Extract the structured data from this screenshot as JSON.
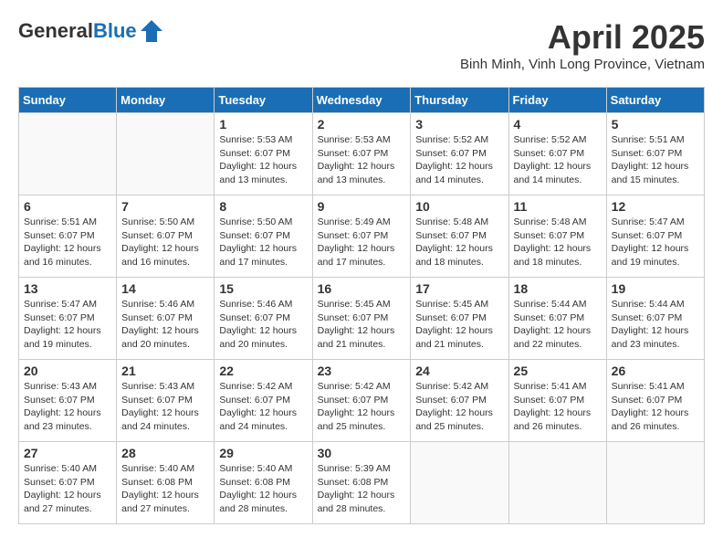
{
  "header": {
    "logo_line1": "General",
    "logo_line2": "Blue",
    "month": "April 2025",
    "location": "Binh Minh, Vinh Long Province, Vietnam"
  },
  "days_of_week": [
    "Sunday",
    "Monday",
    "Tuesday",
    "Wednesday",
    "Thursday",
    "Friday",
    "Saturday"
  ],
  "weeks": [
    [
      {
        "day": "",
        "info": ""
      },
      {
        "day": "",
        "info": ""
      },
      {
        "day": "1",
        "info": "Sunrise: 5:53 AM\nSunset: 6:07 PM\nDaylight: 12 hours\nand 13 minutes."
      },
      {
        "day": "2",
        "info": "Sunrise: 5:53 AM\nSunset: 6:07 PM\nDaylight: 12 hours\nand 13 minutes."
      },
      {
        "day": "3",
        "info": "Sunrise: 5:52 AM\nSunset: 6:07 PM\nDaylight: 12 hours\nand 14 minutes."
      },
      {
        "day": "4",
        "info": "Sunrise: 5:52 AM\nSunset: 6:07 PM\nDaylight: 12 hours\nand 14 minutes."
      },
      {
        "day": "5",
        "info": "Sunrise: 5:51 AM\nSunset: 6:07 PM\nDaylight: 12 hours\nand 15 minutes."
      }
    ],
    [
      {
        "day": "6",
        "info": "Sunrise: 5:51 AM\nSunset: 6:07 PM\nDaylight: 12 hours\nand 16 minutes."
      },
      {
        "day": "7",
        "info": "Sunrise: 5:50 AM\nSunset: 6:07 PM\nDaylight: 12 hours\nand 16 minutes."
      },
      {
        "day": "8",
        "info": "Sunrise: 5:50 AM\nSunset: 6:07 PM\nDaylight: 12 hours\nand 17 minutes."
      },
      {
        "day": "9",
        "info": "Sunrise: 5:49 AM\nSunset: 6:07 PM\nDaylight: 12 hours\nand 17 minutes."
      },
      {
        "day": "10",
        "info": "Sunrise: 5:48 AM\nSunset: 6:07 PM\nDaylight: 12 hours\nand 18 minutes."
      },
      {
        "day": "11",
        "info": "Sunrise: 5:48 AM\nSunset: 6:07 PM\nDaylight: 12 hours\nand 18 minutes."
      },
      {
        "day": "12",
        "info": "Sunrise: 5:47 AM\nSunset: 6:07 PM\nDaylight: 12 hours\nand 19 minutes."
      }
    ],
    [
      {
        "day": "13",
        "info": "Sunrise: 5:47 AM\nSunset: 6:07 PM\nDaylight: 12 hours\nand 19 minutes."
      },
      {
        "day": "14",
        "info": "Sunrise: 5:46 AM\nSunset: 6:07 PM\nDaylight: 12 hours\nand 20 minutes."
      },
      {
        "day": "15",
        "info": "Sunrise: 5:46 AM\nSunset: 6:07 PM\nDaylight: 12 hours\nand 20 minutes."
      },
      {
        "day": "16",
        "info": "Sunrise: 5:45 AM\nSunset: 6:07 PM\nDaylight: 12 hours\nand 21 minutes."
      },
      {
        "day": "17",
        "info": "Sunrise: 5:45 AM\nSunset: 6:07 PM\nDaylight: 12 hours\nand 21 minutes."
      },
      {
        "day": "18",
        "info": "Sunrise: 5:44 AM\nSunset: 6:07 PM\nDaylight: 12 hours\nand 22 minutes."
      },
      {
        "day": "19",
        "info": "Sunrise: 5:44 AM\nSunset: 6:07 PM\nDaylight: 12 hours\nand 23 minutes."
      }
    ],
    [
      {
        "day": "20",
        "info": "Sunrise: 5:43 AM\nSunset: 6:07 PM\nDaylight: 12 hours\nand 23 minutes."
      },
      {
        "day": "21",
        "info": "Sunrise: 5:43 AM\nSunset: 6:07 PM\nDaylight: 12 hours\nand 24 minutes."
      },
      {
        "day": "22",
        "info": "Sunrise: 5:42 AM\nSunset: 6:07 PM\nDaylight: 12 hours\nand 24 minutes."
      },
      {
        "day": "23",
        "info": "Sunrise: 5:42 AM\nSunset: 6:07 PM\nDaylight: 12 hours\nand 25 minutes."
      },
      {
        "day": "24",
        "info": "Sunrise: 5:42 AM\nSunset: 6:07 PM\nDaylight: 12 hours\nand 25 minutes."
      },
      {
        "day": "25",
        "info": "Sunrise: 5:41 AM\nSunset: 6:07 PM\nDaylight: 12 hours\nand 26 minutes."
      },
      {
        "day": "26",
        "info": "Sunrise: 5:41 AM\nSunset: 6:07 PM\nDaylight: 12 hours\nand 26 minutes."
      }
    ],
    [
      {
        "day": "27",
        "info": "Sunrise: 5:40 AM\nSunset: 6:07 PM\nDaylight: 12 hours\nand 27 minutes."
      },
      {
        "day": "28",
        "info": "Sunrise: 5:40 AM\nSunset: 6:08 PM\nDaylight: 12 hours\nand 27 minutes."
      },
      {
        "day": "29",
        "info": "Sunrise: 5:40 AM\nSunset: 6:08 PM\nDaylight: 12 hours\nand 28 minutes."
      },
      {
        "day": "30",
        "info": "Sunrise: 5:39 AM\nSunset: 6:08 PM\nDaylight: 12 hours\nand 28 minutes."
      },
      {
        "day": "",
        "info": ""
      },
      {
        "day": "",
        "info": ""
      },
      {
        "day": "",
        "info": ""
      }
    ]
  ]
}
